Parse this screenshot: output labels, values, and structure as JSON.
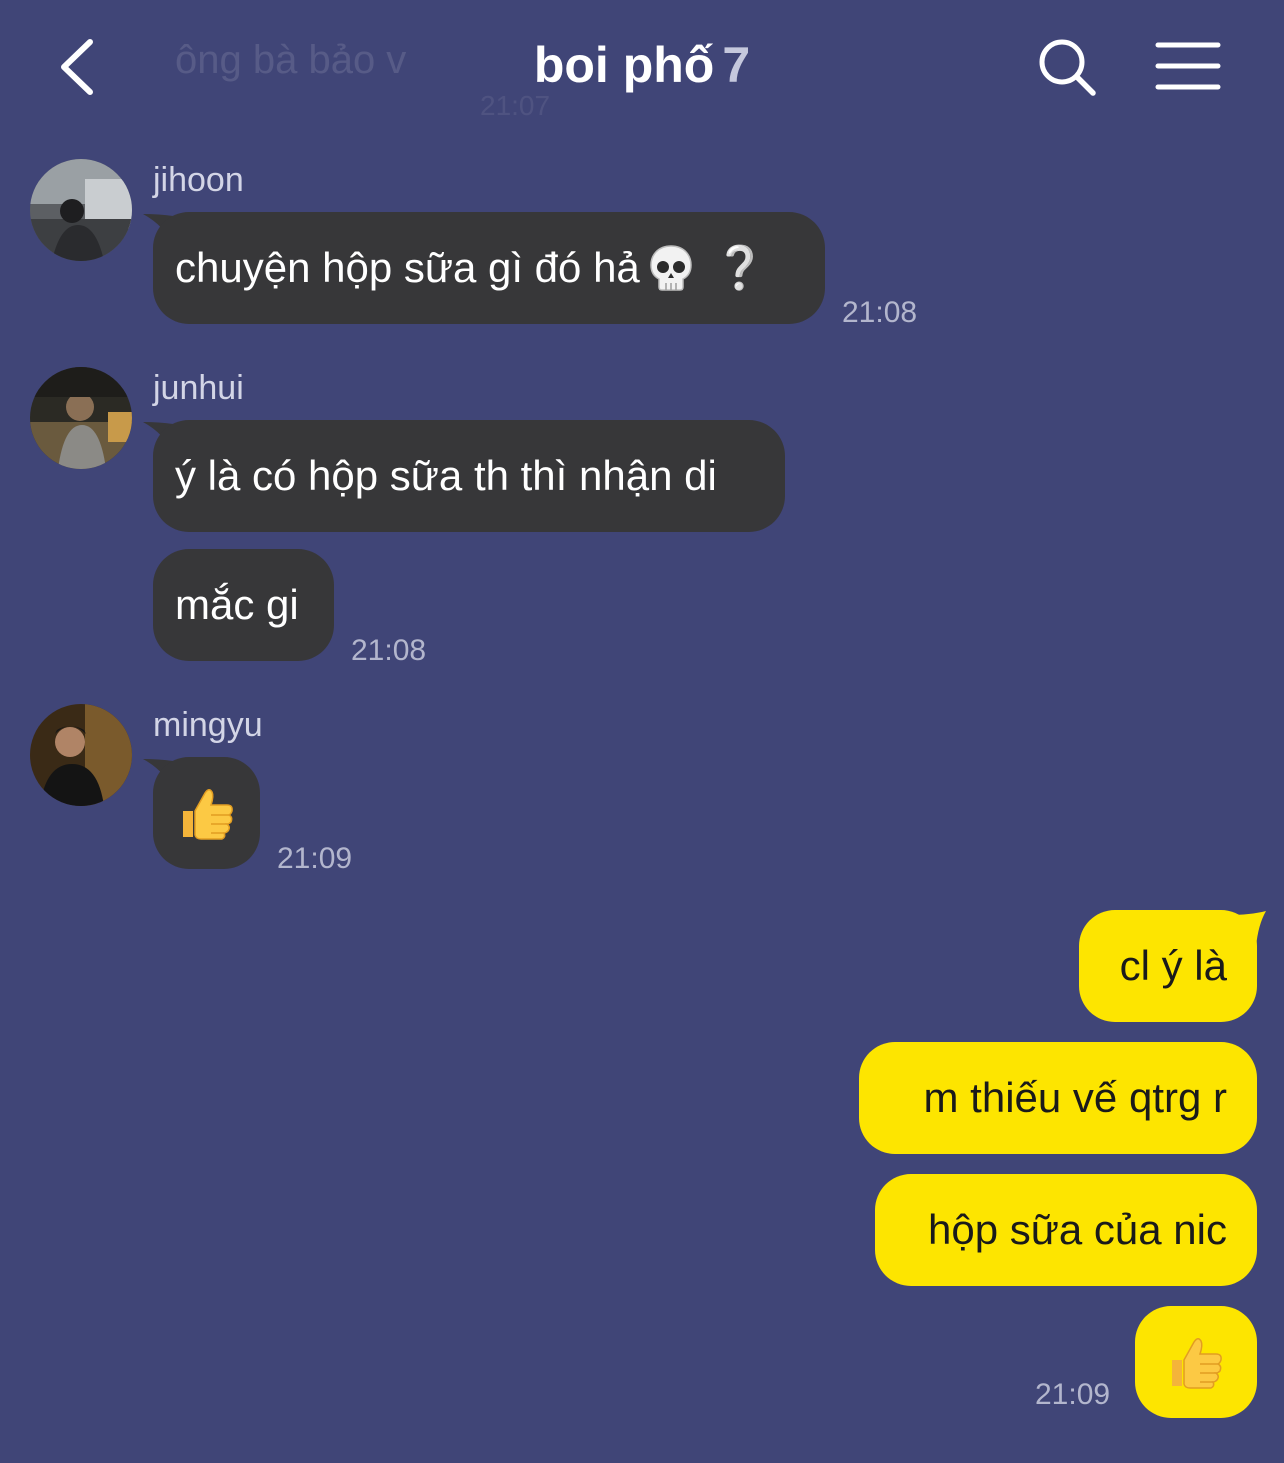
{
  "header": {
    "title": "boi phố",
    "member_count": "7",
    "ghost_preview_text": "ông bà bảo v",
    "ghost_preview_time": "21:07",
    "icons": {
      "back": "chevron-left-icon",
      "search": "search-icon",
      "menu": "hamburger-menu-icon"
    }
  },
  "messages": [
    {
      "sender": "jihoon",
      "text": "chuyện hộp sữa gì đó hả",
      "emoji": "skull",
      "suffix": "❔",
      "time": "21:08"
    },
    {
      "sender": "junhui",
      "text": "ý là có hộp sữa th thì nhận di"
    },
    {
      "text": "mắc gi",
      "time": "21:08"
    },
    {
      "sender": "mingyu",
      "emoji": "thumbs-up",
      "time": "21:09"
    }
  ],
  "outgoing": [
    {
      "text": "cl ý là"
    },
    {
      "text": "m thiếu vế qtrg r"
    },
    {
      "text": "hộp sữa của nic"
    },
    {
      "emoji": "thumbs-up",
      "time": "21:09"
    }
  ],
  "colors": {
    "background": "#404577",
    "incoming_bubble": "#373739",
    "outgoing_bubble": "#fde500",
    "timestamp": "#b3b6cd"
  }
}
